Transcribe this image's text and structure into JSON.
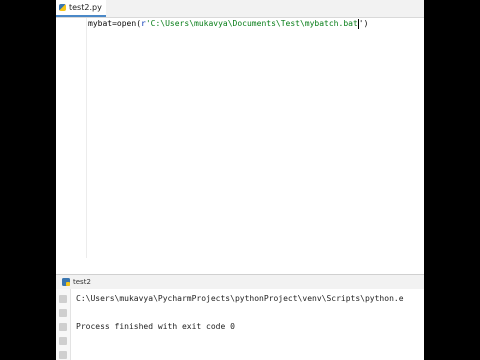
{
  "editor": {
    "tab_label": "test2.py",
    "code": {
      "var": "mybat",
      "eq": "=",
      "func": "open(",
      "prefix": "r",
      "string": "'C:\\Users\\mukavya\\Documents\\Test\\mybatch.bat",
      "after_caret": "')"
    }
  },
  "run_panel": {
    "tab_label": "test2",
    "command_line": "C:\\Users\\mukavya\\PycharmProjects\\pythonProject\\venv\\Scripts\\python.e",
    "exit_line": "Process finished with exit code 0"
  }
}
